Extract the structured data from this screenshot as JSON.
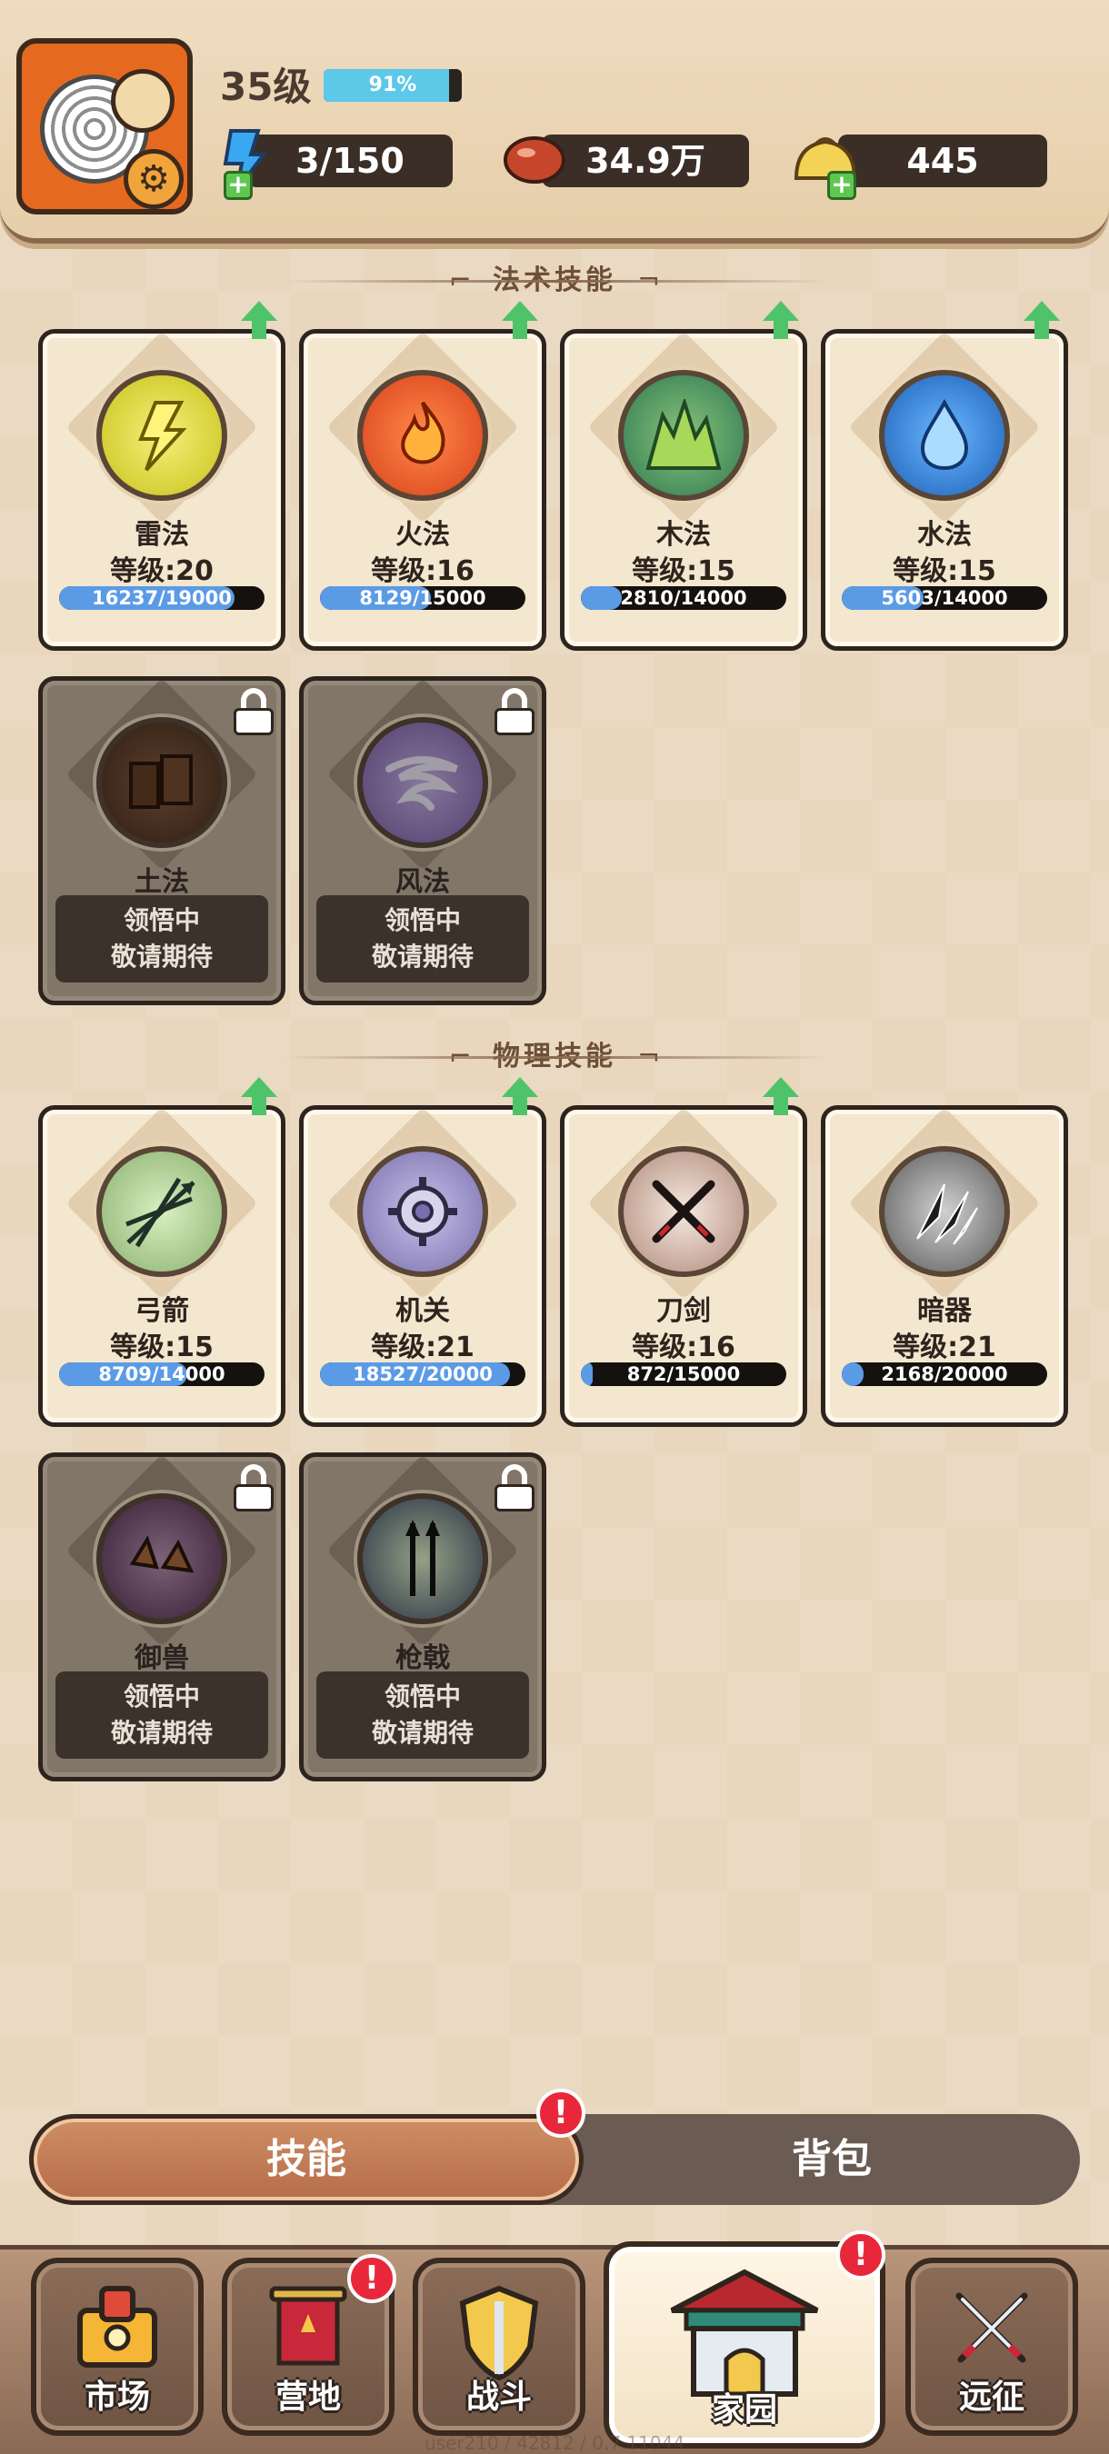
{
  "header": {
    "level": "35级",
    "exp_label": "91%",
    "exp_fraction": 0.91,
    "resources": [
      {
        "icon": "blue-boot-icon",
        "value": "3/150",
        "plus": true
      },
      {
        "icon": "bean-icon",
        "value": "34.9万",
        "plus": false
      },
      {
        "icon": "bun-icon",
        "value": "445",
        "plus": true
      }
    ]
  },
  "sections": {
    "magic_title": "法术技能",
    "physical_title": "物理技能"
  },
  "magic_skills": [
    {
      "name": "雷法",
      "level": "等级:20",
      "progress": "16237/19000",
      "fraction": 0.855,
      "upgradable": true,
      "icon": "thunder-icon"
    },
    {
      "name": "火法",
      "level": "等级:16",
      "progress": "8129/15000",
      "fraction": 0.542,
      "upgradable": true,
      "icon": "fire-icon"
    },
    {
      "name": "木法",
      "level": "等级:15",
      "progress": "2810/14000",
      "fraction": 0.201,
      "upgradable": true,
      "icon": "wood-icon"
    },
    {
      "name": "水法",
      "level": "等级:15",
      "progress": "5603/14000",
      "fraction": 0.4,
      "upgradable": true,
      "icon": "water-icon"
    }
  ],
  "magic_locked": [
    {
      "name": "土法",
      "status_line1": "领悟中",
      "status_line2": "敬请期待",
      "icon": "earth-icon"
    },
    {
      "name": "风法",
      "status_line1": "领悟中",
      "status_line2": "敬请期待",
      "icon": "wind-icon"
    }
  ],
  "physical_skills": [
    {
      "name": "弓箭",
      "level": "等级:15",
      "progress": "8709/14000",
      "fraction": 0.622,
      "upgradable": true,
      "icon": "arrows-icon"
    },
    {
      "name": "机关",
      "level": "等级:21",
      "progress": "18527/20000",
      "fraction": 0.926,
      "upgradable": true,
      "icon": "mechanism-icon"
    },
    {
      "name": "刀剑",
      "level": "等级:16",
      "progress": "872/15000",
      "fraction": 0.058,
      "upgradable": true,
      "icon": "swords-icon"
    },
    {
      "name": "暗器",
      "level": "等级:21",
      "progress": "2168/20000",
      "fraction": 0.108,
      "upgradable": false,
      "icon": "hidden-weapon-icon"
    }
  ],
  "physical_locked": [
    {
      "name": "御兽",
      "status_line1": "领悟中",
      "status_line2": "敬请期待",
      "icon": "beast-icon"
    },
    {
      "name": "枪戟",
      "status_line1": "领悟中",
      "status_line2": "敬请期待",
      "icon": "spear-icon"
    }
  ],
  "tabs": {
    "skills": "技能",
    "bag": "背包",
    "alert": "!"
  },
  "nav": [
    {
      "label": "市场",
      "icon": "market-icon",
      "alert": false
    },
    {
      "label": "营地",
      "icon": "camp-icon",
      "alert": true
    },
    {
      "label": "战斗",
      "icon": "battle-icon",
      "alert": false
    },
    {
      "label": "家园",
      "icon": "home-icon",
      "alert": true
    },
    {
      "label": "远征",
      "icon": "expedition-icon",
      "alert": false
    }
  ],
  "debug_text": "user210 / 42812 / 0.7.11044"
}
